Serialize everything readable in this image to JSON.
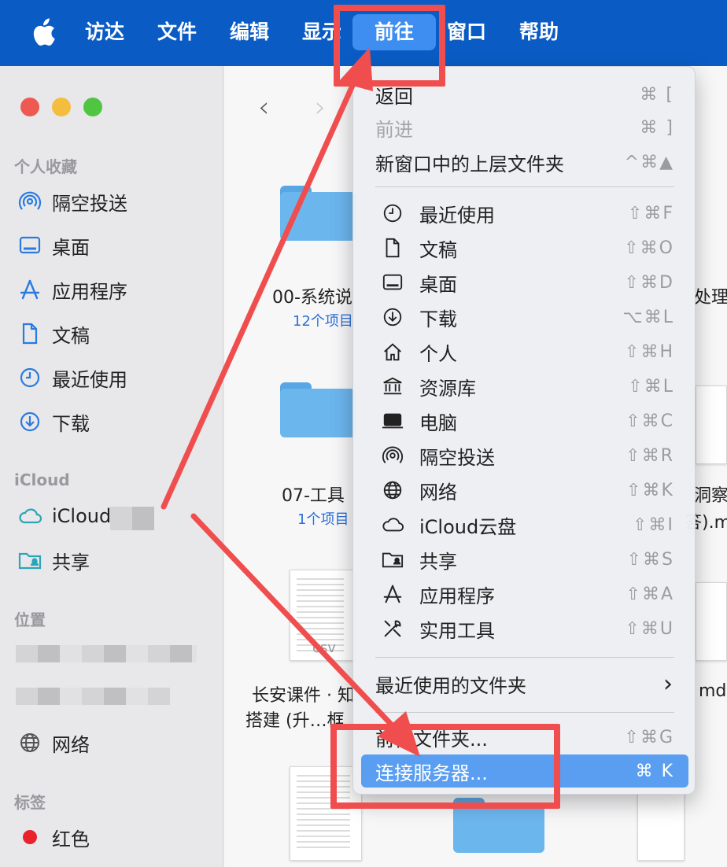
{
  "menubar": {
    "items": [
      "访达",
      "文件",
      "编辑",
      "显示",
      "前往",
      "窗口",
      "帮助"
    ],
    "active": "前往"
  },
  "sidebar": {
    "favorites_header": "个人收藏",
    "favorites": [
      {
        "label": "隔空投送",
        "icon": "airdrop-icon"
      },
      {
        "label": "桌面",
        "icon": "desktop-icon"
      },
      {
        "label": "应用程序",
        "icon": "applications-icon"
      },
      {
        "label": "文稿",
        "icon": "document-icon"
      },
      {
        "label": "最近使用",
        "icon": "clock-icon"
      },
      {
        "label": "下载",
        "icon": "download-icon"
      }
    ],
    "icloud_header": "iCloud",
    "icloud": [
      {
        "label": "iCloud",
        "icon": "cloud-icon"
      },
      {
        "label": "共享",
        "icon": "shared-folder-icon"
      }
    ],
    "locations_header": "位置",
    "locations": [
      {
        "label": "网络",
        "icon": "network-icon"
      }
    ],
    "tags_header": "标签",
    "tags": [
      {
        "label": "红色",
        "color": "#e8232b"
      }
    ]
  },
  "content": {
    "items": [
      {
        "name": "00-系统说",
        "sub": "12个项目"
      },
      {
        "name": "处理",
        "sub": ""
      },
      {
        "name": "07-工具",
        "sub": "1个项目"
      },
      {
        "name": "洞察",
        "sub": ""
      },
      {
        "name": "长安课件 · 知",
        "name2": "搭建 (升…框",
        "sub": ""
      },
      {
        "name": "md",
        "sub": ""
      }
    ],
    "doc_tag": "csv",
    "right_fragment": "答).m"
  },
  "menu": {
    "items": [
      {
        "label": "返回",
        "shortcut": "⌘ [",
        "disabled": false
      },
      {
        "label": "前进",
        "shortcut": "⌘ ]",
        "disabled": true
      },
      {
        "label": "新窗口中的上层文件夹",
        "shortcut": "^⌘▲",
        "disabled": false
      },
      {
        "label": "最近使用",
        "shortcut": "⇧⌘F",
        "icon": "clock-icon"
      },
      {
        "label": "文稿",
        "shortcut": "⇧⌘O",
        "icon": "document-icon"
      },
      {
        "label": "桌面",
        "shortcut": "⇧⌘D",
        "icon": "desktop-icon"
      },
      {
        "label": "下载",
        "shortcut": "⌥⌘L",
        "icon": "download-icon"
      },
      {
        "label": "个人",
        "shortcut": "⇧⌘H",
        "icon": "home-icon"
      },
      {
        "label": "资源库",
        "shortcut": "⇧⌘L",
        "icon": "library-icon"
      },
      {
        "label": "电脑",
        "shortcut": "⇧⌘C",
        "icon": "computer-icon"
      },
      {
        "label": "隔空投送",
        "shortcut": "⇧⌘R",
        "icon": "airdrop-icon"
      },
      {
        "label": "网络",
        "shortcut": "⇧⌘K",
        "icon": "network-icon"
      },
      {
        "label": "iCloud云盘",
        "shortcut": "⇧⌘I",
        "icon": "cloud-icon"
      },
      {
        "label": "共享",
        "shortcut": "⇧⌘S",
        "icon": "shared-folder-icon"
      },
      {
        "label": "应用程序",
        "shortcut": "⇧⌘A",
        "icon": "applications-icon"
      },
      {
        "label": "实用工具",
        "shortcut": "⇧⌘U",
        "icon": "utilities-icon"
      },
      {
        "label": "最近使用的文件夹",
        "shortcut": "›"
      },
      {
        "label": "前往文件夹...",
        "shortcut": "⇧⌘G"
      },
      {
        "label": "连接服务器...",
        "shortcut": "⌘ K",
        "selected": true
      }
    ]
  },
  "colors": {
    "menubar": "#0a5cc4",
    "annotation": "#f04e4e",
    "selection": "#5a9ef2",
    "folder": "#6cb6ee"
  }
}
